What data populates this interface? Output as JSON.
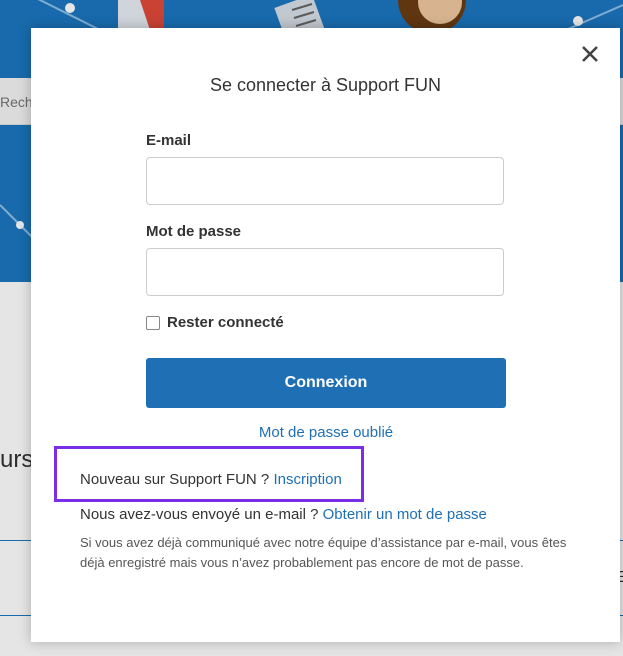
{
  "background": {
    "search_fragment": "Rech",
    "section_fragment": "urs",
    "right_fragment": "E"
  },
  "modal": {
    "title": "Se connecter à Support FUN",
    "close_icon": "close-icon",
    "email_label": "E-mail",
    "email_value": "",
    "password_label": "Mot de passe",
    "password_value": "",
    "remember_label": "Rester connecté",
    "remember_checked": false,
    "submit_label": "Connexion",
    "forgot_label": "Mot de passe oublié",
    "register_prompt": "Nouveau sur Support FUN ?",
    "register_link": "Inscription",
    "email_prompt": "Nous avez-vous envoyé un e-mail ?",
    "email_link": "Obtenir un mot de passe",
    "info": "Si vous avez déjà communiqué avec notre équipe d’assistance par e-mail, vous êtes déjà enregistré mais vous n’avez probablement pas encore de mot de passe."
  },
  "colors": {
    "brand_blue": "#1b76c0",
    "button_blue": "#1f6fb5",
    "highlight_purple": "#7a2ee8"
  }
}
